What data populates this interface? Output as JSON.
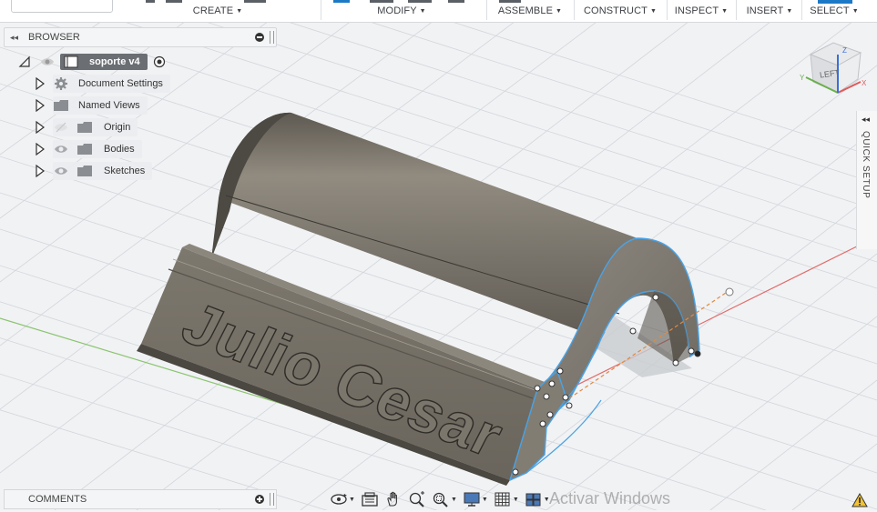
{
  "toolbar": {
    "groups": [
      {
        "label": "CREATE"
      },
      {
        "label": "MODIFY"
      },
      {
        "label": "ASSEMBLE"
      },
      {
        "label": "CONSTRUCT"
      },
      {
        "label": "INSPECT"
      },
      {
        "label": "INSERT"
      },
      {
        "label": "SELECT"
      }
    ],
    "caret": "▼"
  },
  "browser": {
    "title": "BROWSER",
    "collapse_glyph": "◂◂",
    "root": {
      "label": "soporte v4"
    },
    "items": [
      {
        "label": "Document Settings",
        "icon": "gear-icon"
      },
      {
        "label": "Named Views",
        "icon": "folder-icon"
      },
      {
        "label": "Origin",
        "icon": "folder-icon",
        "visibility": "hidden"
      },
      {
        "label": "Bodies",
        "icon": "folder-icon",
        "visibility": "visible"
      },
      {
        "label": "Sketches",
        "icon": "folder-icon",
        "visibility": "visible"
      }
    ]
  },
  "viewcube": {
    "face_label": "LEFT",
    "axis_x": "X",
    "axis_y": "Y",
    "axis_z": "Z"
  },
  "quick_setup": {
    "label": "QUICK SETUP",
    "chevron": "◂◂"
  },
  "model": {
    "embossed_text": "Julio Cesar"
  },
  "comments": {
    "title": "COMMENTS"
  },
  "watermark": {
    "text": "Activar Windows"
  },
  "colors": {
    "body": "#6b6559",
    "edge_highlight": "#4aa3e6",
    "grid": "#cfd3d8",
    "x_axis": "#e05a5a",
    "y_axis": "#6ab04c",
    "toolbar_accent": "#1c79c6"
  }
}
